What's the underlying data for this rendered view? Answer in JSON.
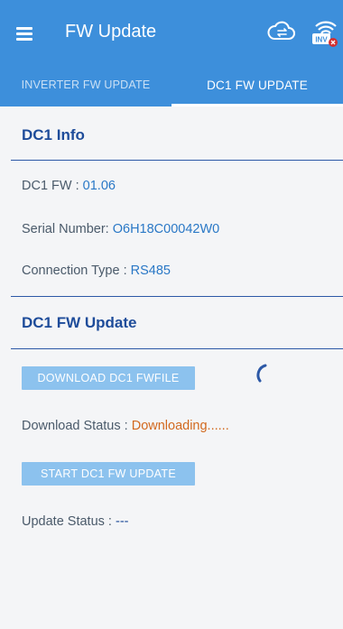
{
  "app_bar": {
    "title": "FW Update",
    "icons": [
      "menu-icon",
      "cloud-sync-icon",
      "inverter-wifi-status-icon"
    ],
    "accent_color": "#3d8fdb"
  },
  "tabs": [
    {
      "label": "INVERTER FW UPDATE",
      "active": false
    },
    {
      "label": "DC1 FW UPDATE",
      "active": true
    }
  ],
  "info": {
    "title": "DC1 Info",
    "fw_label": "DC1 FW :",
    "fw_value": "01.06",
    "serial_label": "Serial Number:",
    "serial_value": "O6H18C00042W0",
    "conn_label": "Connection Type :",
    "conn_value": "RS485"
  },
  "update": {
    "title": "DC1 FW Update",
    "download_button": "DOWNLOAD DC1 FWFILE",
    "download_status_label": "Download Status :",
    "download_status_value": "Downloading......",
    "start_button": "START DC1 FW UPDATE",
    "update_status_label": "Update Status :",
    "update_status_value": "---"
  }
}
